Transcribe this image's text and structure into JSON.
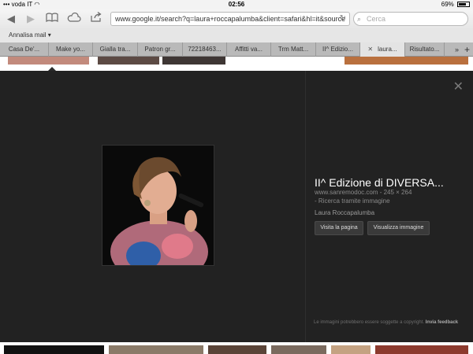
{
  "status": {
    "carrier": "voda IT",
    "time": "02:56",
    "battery": "69%"
  },
  "toolbar": {
    "url": "www.google.it/search?q=laura+roccapalumba&client=safari&hl=it&source",
    "search_placeholder": "Cerca"
  },
  "bookmarks": {
    "label": "Annalisa mail ▾"
  },
  "tabs": [
    "Casa De'...",
    "Make yo...",
    "Gialla tra...",
    "Patron gr...",
    "72218463...",
    "Affitti va...",
    "Trm Matt...",
    "II^ Edizio...",
    "laura...",
    "Risultato..."
  ],
  "detail": {
    "title": "II^ Edizione di DIVERSA...",
    "source": "www.sanremodoc.com - 245 × 264",
    "reverse_search": "- Ricerca tramite immagine",
    "description": "Laura Roccapalumba",
    "visit_button": "Visita la pagina",
    "view_button": "Visualizza immagine",
    "notice": "Le immagini potrebbero essere soggette a copyright.",
    "feedback_link": "Invia feedback"
  },
  "colors": {
    "panel_bg": "#222222",
    "accent_text": "#ffffff"
  }
}
